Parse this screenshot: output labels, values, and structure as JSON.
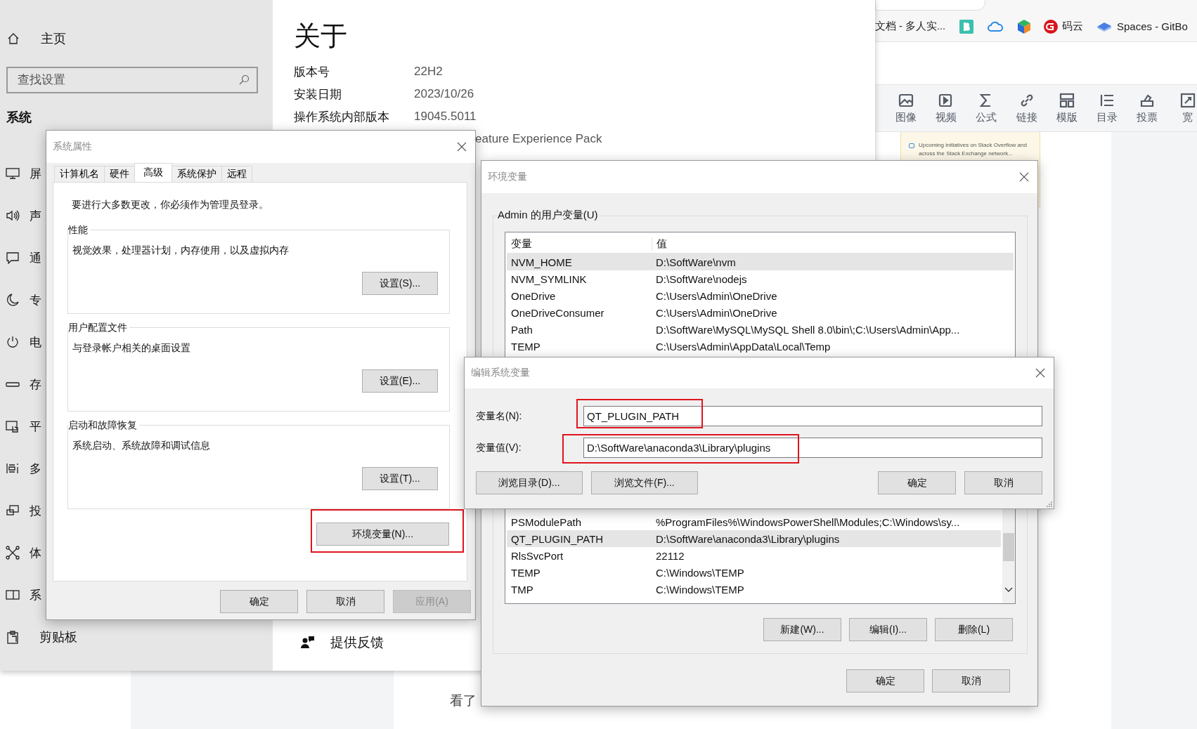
{
  "settings": {
    "sidebar": {
      "home": {
        "label": "主页"
      },
      "search": {
        "placeholder": "查找设置"
      },
      "section": "系统",
      "items": [
        {
          "label": "屏"
        },
        {
          "label": "声"
        },
        {
          "label": "通"
        },
        {
          "label": "专"
        },
        {
          "label": "电"
        },
        {
          "label": "存"
        },
        {
          "label": "平"
        },
        {
          "label": "多"
        },
        {
          "label": "投"
        },
        {
          "label": "体"
        },
        {
          "label": "系"
        },
        {
          "label": "剪贴板"
        }
      ]
    },
    "about": {
      "title": "关于",
      "specs": [
        {
          "label": "版本号",
          "value": "22H2"
        },
        {
          "label": "安装日期",
          "value": "2023/10/26"
        },
        {
          "label": "操作系统内部版本",
          "value": "19045.5011"
        }
      ],
      "experience_fragment": "eature Experience Pack",
      "feedback": "提供反馈"
    }
  },
  "browser": {
    "bookmarks": [
      {
        "kind": "text",
        "label": "文档 - 多人实..."
      },
      {
        "kind": "icon"
      },
      {
        "kind": "icon"
      },
      {
        "kind": "icon"
      },
      {
        "kind": "link",
        "label": "码云"
      },
      {
        "kind": "link",
        "label": "Spaces - GitBo"
      }
    ],
    "toolbar": [
      {
        "label": "图像"
      },
      {
        "label": "视频"
      },
      {
        "label": "公式"
      },
      {
        "label": "链接"
      },
      {
        "label": "模版"
      },
      {
        "label": "目录"
      },
      {
        "label": "投票"
      },
      {
        "label": "宽"
      }
    ],
    "notice": "Upcoming initiatives on Stack Overflow and across the Stack Exchange network..."
  },
  "article_fragment": "看了",
  "system_properties": {
    "title": "系统属性",
    "tabs": [
      {
        "label": "计算机名",
        "selected": false
      },
      {
        "label": "硬件",
        "selected": false
      },
      {
        "label": "高级",
        "selected": true
      },
      {
        "label": "系统保护",
        "selected": false
      },
      {
        "label": "远程",
        "selected": false
      }
    ],
    "notice": "要进行大多数更改，你必须作为管理员登录。",
    "groups": [
      {
        "legend": "性能",
        "description": "视觉效果，处理器计划，内存使用，以及虚拟内存",
        "button": "设置(S)..."
      },
      {
        "legend": "用户配置文件",
        "description": "与登录帐户相关的桌面设置",
        "button": "设置(E)..."
      },
      {
        "legend": "启动和故障恢复",
        "description": "系统启动、系统故障和调试信息",
        "button": "设置(T)..."
      }
    ],
    "env_button": {
      "label": "环境变量(N)...",
      "highlighted": true
    },
    "buttons": [
      {
        "label": "确定",
        "disabled": false
      },
      {
        "label": "取消",
        "disabled": false
      },
      {
        "label": "应用(A)",
        "disabled": true
      }
    ]
  },
  "environment_variables": {
    "title": "环境变量",
    "user_group": "Admin 的用户变量(U)",
    "columns": [
      "变量",
      "值"
    ],
    "user_rows": [
      {
        "name": "NVM_HOME",
        "value": "D:\\SoftWare\\nvm",
        "selected": true
      },
      {
        "name": "NVM_SYMLINK",
        "value": "D:\\SoftWare\\nodejs",
        "selected": false
      },
      {
        "name": "OneDrive",
        "value": "C:\\Users\\Admin\\OneDrive",
        "selected": false
      },
      {
        "name": "OneDriveConsumer",
        "value": "C:\\Users\\Admin\\OneDrive",
        "selected": false
      },
      {
        "name": "Path",
        "value": "D:\\SoftWare\\MySQL\\MySQL Shell 8.0\\bin\\;C:\\Users\\Admin\\App...",
        "selected": false
      },
      {
        "name": "TEMP",
        "value": "C:\\Users\\Admin\\AppData\\Local\\Temp",
        "selected": false
      }
    ],
    "system_rows": [
      {
        "name": "PSModulePath",
        "value": "%ProgramFiles%\\WindowsPowerShell\\Modules;C:\\Windows\\sy...",
        "selected": false
      },
      {
        "name": "QT_PLUGIN_PATH",
        "value": "D:\\SoftWare\\anaconda3\\Library\\plugins",
        "selected": true
      },
      {
        "name": "RlsSvcPort",
        "value": "22112",
        "selected": false
      },
      {
        "name": "TEMP",
        "value": "C:\\Windows\\TEMP",
        "selected": false
      },
      {
        "name": "TMP",
        "value": "C:\\Windows\\TEMP",
        "selected": false
      }
    ],
    "system_buttons": [
      "新建(W)...",
      "编辑(I)...",
      "删除(L)"
    ],
    "buttons": [
      "确定",
      "取消"
    ]
  },
  "edit_variable": {
    "title": "编辑系统变量",
    "fields": [
      {
        "label": "变量名(N):",
        "value": "QT_PLUGIN_PATH",
        "highlighted": true
      },
      {
        "label": "变量值(V):",
        "value": "D:\\SoftWare\\anaconda3\\Library\\plugins",
        "highlighted": true
      }
    ],
    "browse_buttons": [
      "浏览目录(D)...",
      "浏览文件(F)..."
    ],
    "buttons": [
      "确定",
      "取消"
    ]
  }
}
